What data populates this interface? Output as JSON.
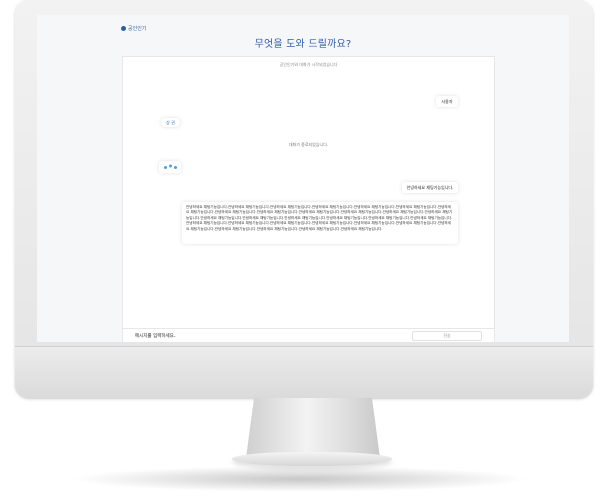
{
  "brand": {
    "name": "공인인기"
  },
  "page": {
    "title": "무엇을 도와 드릴까요?"
  },
  "chat": {
    "header": "공인인기와 대화가 시작되었습니다",
    "messages": {
      "user1": "사용자",
      "bot_chip": "상 권",
      "status": "대화가 종료되었습니다.",
      "user2": "안녕하세요 채팅기능입니다.",
      "long": "안녕하세요 채팅기능입니다.안녕하세요 채팅기능입니다.안녕하세요 채팅기능입니다.안녕하세요 채팅기능입니다.안녕하세요 채팅기능입니다.안녕하세요 채팅기능입니다.안녕하세요 채팅기능입니다.안녕하세요 채팅기능입니다.안녕하세요 채팅기능입니다.안녕하세요 채팅기능입니다.안녕하세요 채팅기능입니다.안녕하세요 채팅기능입니다.안녕하세요 채팅기능입니다.안녕하세요 채팅기능입니다.안녕하세요 채팅기능입니다.안녕하세요 채팅기능입니다.안녕하세요 채팅기능입니다.안녕하세요 채팅기능입니다.안녕하세요 채팅기능입니다.안녕하세요 채팅기능입니다.안녕하세요 채팅기능입니다.안녕하세요 채팅기능입니다.안녕하세요 채팅기능입니다.안녕하세요 채팅기능입니다.안녕하세요 채팅기능입니다.안녕하세요 채팅기능입니다.안녕하세요 채팅기능입니다.안녕하세요 채팅기능입니다.안녕하세요 채팅기능입니다.안녕하세요 채팅기능입니다."
    },
    "input": {
      "placeholder": "메시지를 입력하세요."
    },
    "send_label": "전송"
  },
  "colors": {
    "accent": "#2f5fa7",
    "typing_dot": "#4aa3df"
  },
  "icons": {
    "brand": "logo-icon",
    "typing": "typing-dots-icon"
  }
}
